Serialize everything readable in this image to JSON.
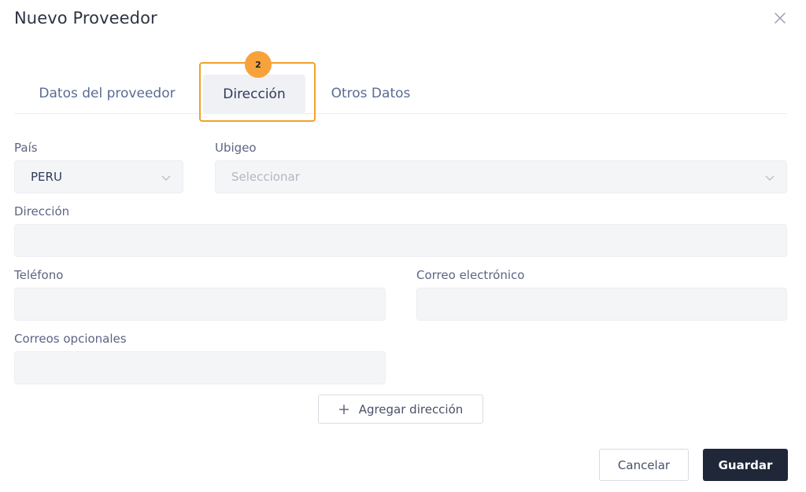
{
  "modal": {
    "title": "Nuevo Proveedor"
  },
  "tabs": [
    {
      "label": "Datos del proveedor"
    },
    {
      "label": "Dirección",
      "active": true
    },
    {
      "label": "Otros Datos"
    }
  ],
  "step_badge": "2",
  "form": {
    "pais": {
      "label": "País",
      "value": "PERU"
    },
    "ubigeo": {
      "label": "Ubigeo",
      "placeholder": "Seleccionar"
    },
    "direccion": {
      "label": "Dirección",
      "value": ""
    },
    "telefono": {
      "label": "Teléfono",
      "value": ""
    },
    "correo": {
      "label": "Correo electrónico",
      "value": ""
    },
    "correos_opcionales": {
      "label": "Correos opcionales",
      "value": ""
    }
  },
  "add_address_label": "Agregar dirección",
  "footer": {
    "cancel_label": "Cancelar",
    "save_label": "Guardar"
  },
  "colors": {
    "highlight": "#f0a12b",
    "badge": "#f7a23a",
    "primary_button": "#1f2738"
  }
}
